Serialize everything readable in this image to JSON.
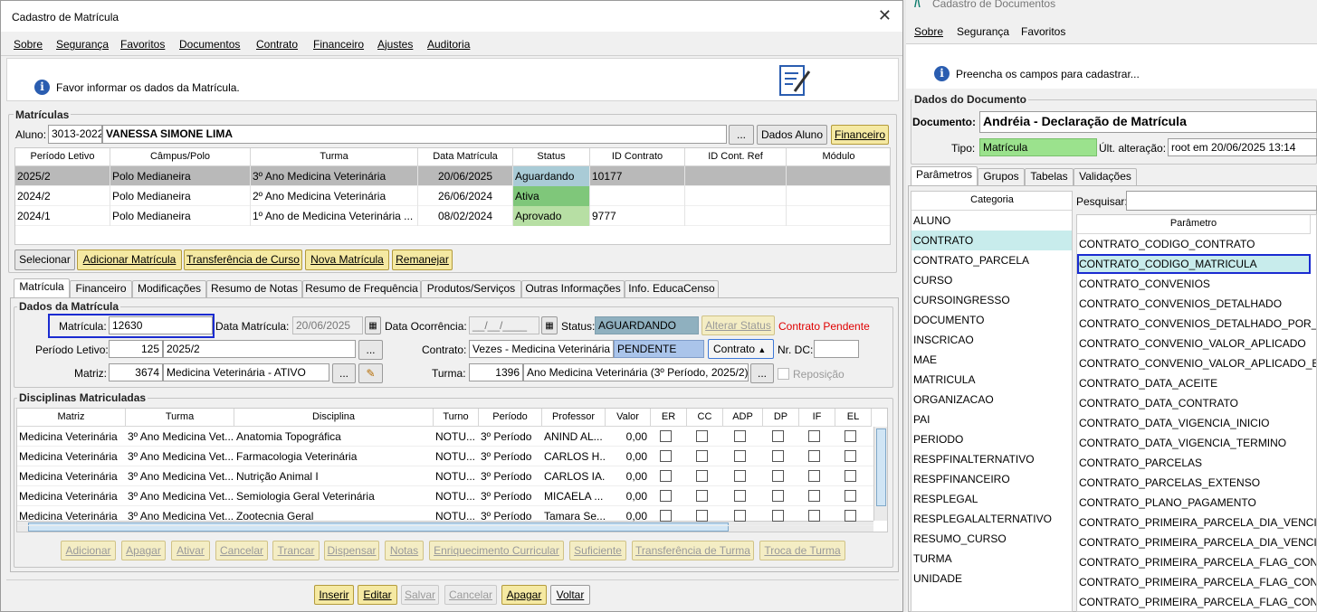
{
  "main": {
    "title": "Cadastro de Matrícula",
    "close": "✕",
    "menu": [
      "Sobre",
      "Segurança",
      "Favoritos",
      "Documentos",
      "Contrato",
      "Financeiro",
      "Ajustes",
      "Auditoria"
    ],
    "info": "Favor informar os dados da Matrícula.",
    "matriculas": {
      "legend": "Matrículas",
      "aluno_label": "Aluno:",
      "aluno_code": "3013-2022",
      "aluno_name": "VANESSA SIMONE LIMA",
      "btn_dots": "...",
      "btn_dados": "Dados Aluno",
      "btn_fin": "Financeiro",
      "headers": [
        "Período Letivo",
        "Câmpus/Polo",
        "Turma",
        "Data Matrícula",
        "Status",
        "ID Contrato",
        "ID Cont. Ref",
        "Módulo"
      ],
      "rows": [
        [
          "2025/2",
          "Polo Medianeira",
          "3º Ano Medicina Veterinária",
          "20/06/2025",
          "Aguardando",
          "10177",
          "",
          ""
        ],
        [
          "2024/2",
          "Polo Medianeira",
          "2º Ano Medicina Veterinária",
          "26/06/2024",
          "Ativa",
          "",
          "",
          ""
        ],
        [
          "2024/1",
          "Polo Medianeira",
          "1º Ano de Medicina Veterinária ...",
          "08/02/2024",
          "Aprovado",
          "9777",
          "",
          ""
        ]
      ],
      "status_colors": [
        "#a9cbd6",
        "#7fc77a",
        "#b7dfa4"
      ],
      "buttons": [
        "Selecionar",
        "Adicionar Matrícula",
        "Transferência de Curso",
        "Nova Matrícula",
        "Remanejar"
      ]
    },
    "tabs": [
      "Matrícula",
      "Financeiro",
      "Modificações",
      "Resumo de Notas",
      "Resumo de Frequência",
      "Produtos/Serviços",
      "Outras Informações",
      "Info. EducaCenso"
    ],
    "dados": {
      "legend": "Dados da Matrícula",
      "matricula_label": "Matrícula:",
      "matricula": "12630",
      "data_label": "Data Matrícula:",
      "data": "20/06/2025",
      "ocorr_label": "Data Ocorrência:",
      "ocorr": "__/__/____",
      "status_label": "Status:",
      "status": "AGUARDANDO",
      "alterar": "Alterar Status",
      "pendente": "Contrato Pendente",
      "periodo_label": "Período Letivo:",
      "periodo_code": "125",
      "periodo": "2025/2",
      "contrato_label": "Contrato:",
      "contrato": "Vezes - Medicina Veterinária",
      "contrato_status": "PENDENTE",
      "contrato_btn": "Contrato",
      "nrdc_label": "Nr. DC:",
      "matriz_label": "Matriz:",
      "matriz_code": "3674",
      "matriz": "Medicina Veterinária - ATIVO",
      "turma_label": "Turma:",
      "turma_code": "1396",
      "turma": "Ano Medicina Veterinária (3º Período, 2025/2)",
      "reposicao": "Reposição"
    },
    "disc": {
      "legend": "Disciplinas Matriculadas",
      "headers": [
        "Matriz",
        "Turma",
        "Disciplina",
        "Turno",
        "Período",
        "Professor",
        "Valor",
        "ER",
        "CC",
        "ADP",
        "DP",
        "IF",
        "EL"
      ],
      "rows": [
        [
          "Medicina Veterinária",
          "3º Ano Medicina Vet...",
          "Anatomia Topográfica",
          "NOTU...",
          "3º Período",
          "ANIND AL...",
          "0,00"
        ],
        [
          "Medicina Veterinária",
          "3º Ano Medicina Vet...",
          "Farmacologia Veterinária",
          "NOTU...",
          "3º Período",
          "CARLOS H...",
          "0,00"
        ],
        [
          "Medicina Veterinária",
          "3º Ano Medicina Vet...",
          "Nutrição Animal I",
          "NOTU...",
          "3º Período",
          "CARLOS IA...",
          "0,00"
        ],
        [
          "Medicina Veterinária",
          "3º Ano Medicina Vet...",
          "Semiologia Geral Veterinária",
          "NOTU...",
          "3º Período",
          "MICAELA ...",
          "0,00"
        ],
        [
          "Medicina Veterinária",
          "3º Ano Medicina Vet...",
          "Zootecnia Geral",
          "NOTU...",
          "3º Período",
          "Tamara Se...",
          "0,00"
        ]
      ],
      "buttons": [
        "Adicionar",
        "Apagar",
        "Ativar",
        "Cancelar",
        "Trancar",
        "Dispensar",
        "Notas",
        "Enriquecimento Curricular",
        "Suficiente",
        "Transferência de Turma",
        "Troca de Turma"
      ]
    },
    "bottom": [
      "Inserir",
      "Editar",
      "Salvar",
      "Cancelar",
      "Apagar",
      "Voltar"
    ]
  },
  "right": {
    "title": "Cadastro de Documentos",
    "menu": [
      "Sobre",
      "Segurança",
      "Favoritos"
    ],
    "info": "Preencha os campos para cadastrar...",
    "legend": "Dados do Documento",
    "doc_label": "Documento:",
    "doc": "Andréia - Declaração de Matrícula",
    "tipo_label": "Tipo:",
    "tipo": "Matrícula",
    "ult_label": "Últ. alteração:",
    "ult": "root em 20/06/2025 13:14",
    "tabs": [
      "Parâmetros",
      "Grupos",
      "Tabelas",
      "Validações"
    ],
    "cat_header": "Categoria",
    "categories": [
      "ALUNO",
      "CONTRATO",
      "CONTRATO_PARCELA",
      "CURSO",
      "CURSOINGRESSO",
      "DOCUMENTO",
      "INSCRICAO",
      "MAE",
      "MATRICULA",
      "ORGANIZACAO",
      "PAI",
      "PERIODO",
      "RESPFINALTERNATIVO",
      "RESPFINANCEIRO",
      "RESPLEGAL",
      "RESPLEGALALTERNATIVO",
      "RESUMO_CURSO",
      "TURMA",
      "UNIDADE"
    ],
    "search_label": "Pesquisar:",
    "param_header": "Parâmetro",
    "params": [
      "CONTRATO_CODIGO_CONTRATO",
      "CONTRATO_CODIGO_MATRICULA",
      "CONTRATO_CONVENIOS",
      "CONTRATO_CONVENIOS_DETALHADO",
      "CONTRATO_CONVENIOS_DETALHADO_POR_P...",
      "CONTRATO_CONVENIO_VALOR_APLICADO",
      "CONTRATO_CONVENIO_VALOR_APLICADO_E...",
      "CONTRATO_DATA_ACEITE",
      "CONTRATO_DATA_CONTRATO",
      "CONTRATO_DATA_VIGENCIA_INICIO",
      "CONTRATO_DATA_VIGENCIA_TERMINO",
      "CONTRATO_PARCELAS",
      "CONTRATO_PARCELAS_EXTENSO",
      "CONTRATO_PLANO_PAGAMENTO",
      "CONTRATO_PRIMEIRA_PARCELA_DIA_VENCIM...",
      "CONTRATO_PRIMEIRA_PARCELA_DIA_VENCIM...",
      "CONTRATO_PRIMEIRA_PARCELA_FLAG_CONT...",
      "CONTRATO_PRIMEIRA_PARCELA_FLAG_CONT...",
      "CONTRATO_PRIMEIRA_PARCELA_FLAG_CONT..."
    ]
  }
}
